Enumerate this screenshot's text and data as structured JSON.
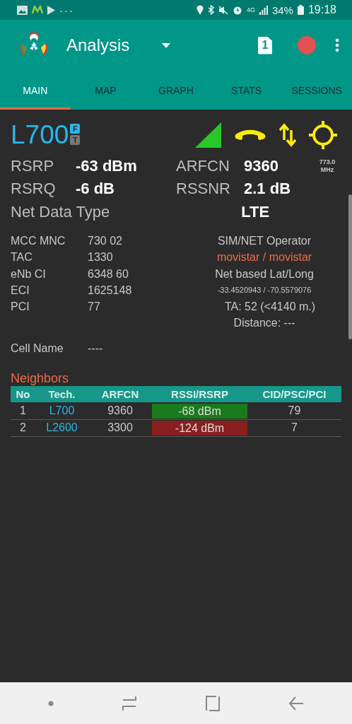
{
  "status_bar": {
    "more": "···",
    "network": "4G",
    "battery": "34%",
    "time": "19:18"
  },
  "app_bar": {
    "title": "Analysis",
    "sim_badge": "1"
  },
  "tabs": [
    {
      "label": "MAIN",
      "selected": true
    },
    {
      "label": "MAP",
      "selected": false
    },
    {
      "label": "GRAPH",
      "selected": false
    },
    {
      "label": "STATS",
      "selected": false
    },
    {
      "label": "SESSIONS",
      "selected": false
    }
  ],
  "cell": {
    "tech": "L700",
    "badges": [
      {
        "label": "F",
        "selected": true
      },
      {
        "label": "T",
        "selected": false
      }
    ]
  },
  "metrics": [
    {
      "label": "RSRP",
      "value": "-63 dBm",
      "label_2": "ARFCN",
      "value_2": "9360"
    },
    {
      "label": "RSRQ",
      "value": "-6 dB",
      "label_2": "RSSNR",
      "value_2": "2.1 dB"
    }
  ],
  "frequency": {
    "value": "773.0",
    "unit": "MHz"
  },
  "net_data_type": {
    "label": "Net Data Type",
    "value": "LTE"
  },
  "info": [
    {
      "label": "MCC MNC",
      "value": "730 02"
    },
    {
      "label": "TAC",
      "value": "1330"
    },
    {
      "label": "eNb CI",
      "value": "6348 60"
    },
    {
      "label": "ECI",
      "value": "1625148"
    },
    {
      "label": "PCI",
      "value": "77"
    }
  ],
  "operator": {
    "label": "SIM/NET Operator",
    "value": "movistar / movistar",
    "location_label": "Net based Lat/Long",
    "location": "-33.4520943 / -70.5579076",
    "ta": "TA: 52 (<4140 m.)",
    "distance": "Distance: ---"
  },
  "cell_name": {
    "label": "Cell Name",
    "value": "----"
  },
  "neighbors": {
    "title": "Neighbors",
    "columns": [
      "No",
      "Tech.",
      "ARFCN",
      "RSSI/RSRP",
      "CID/PSC/PCI"
    ],
    "rows": [
      {
        "no": "1",
        "tech": "L700",
        "arfcn": "9360",
        "rssi": "-68 dBm",
        "color": "#1b7a1b",
        "cid": "79"
      },
      {
        "no": "2",
        "tech": "L2600",
        "arfcn": "3300",
        "rssi": "-124 dBm",
        "color": "#8a1f1f",
        "cid": "7"
      }
    ]
  }
}
